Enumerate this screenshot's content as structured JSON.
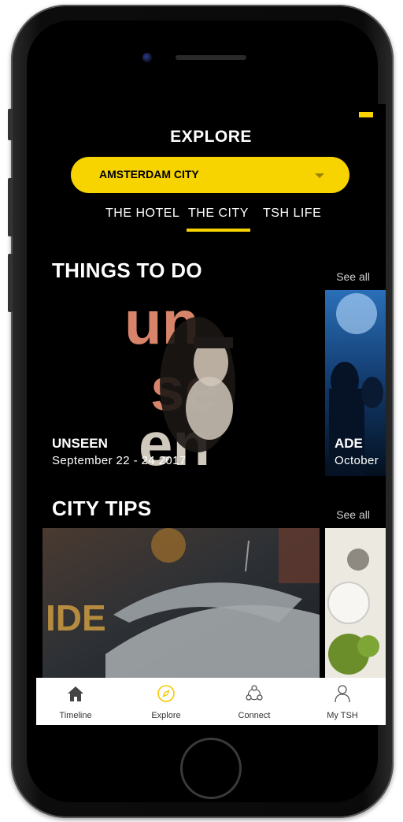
{
  "header": {
    "title": "EXPLORE"
  },
  "city_selector": {
    "value": "AMSTERDAM CITY",
    "icon": "chevron-down-icon"
  },
  "tabs": [
    {
      "label": "THE HOTEL",
      "active": false
    },
    {
      "label": "THE CITY",
      "active": true
    },
    {
      "label": "TSH LIFE",
      "active": false
    }
  ],
  "things_to_do": {
    "title": "THINGS TO DO",
    "see_all": "See all",
    "cards": [
      {
        "title": "UNSEEN",
        "date": "September 22 - 24 2017"
      },
      {
        "title": "ADE",
        "date": "October"
      }
    ]
  },
  "city_tips": {
    "title": "CITY TIPS",
    "see_all": "See all"
  },
  "tab_bar": [
    {
      "label": "Timeline",
      "icon": "home-icon",
      "active": false
    },
    {
      "label": "Explore",
      "icon": "compass-icon",
      "active": true
    },
    {
      "label": "Connect",
      "icon": "connect-icon",
      "active": false
    },
    {
      "label": "My TSH",
      "icon": "user-icon",
      "active": false
    }
  ],
  "colors": {
    "accent": "#f7d300",
    "background": "#000000",
    "tabbar": "#ffffff"
  }
}
